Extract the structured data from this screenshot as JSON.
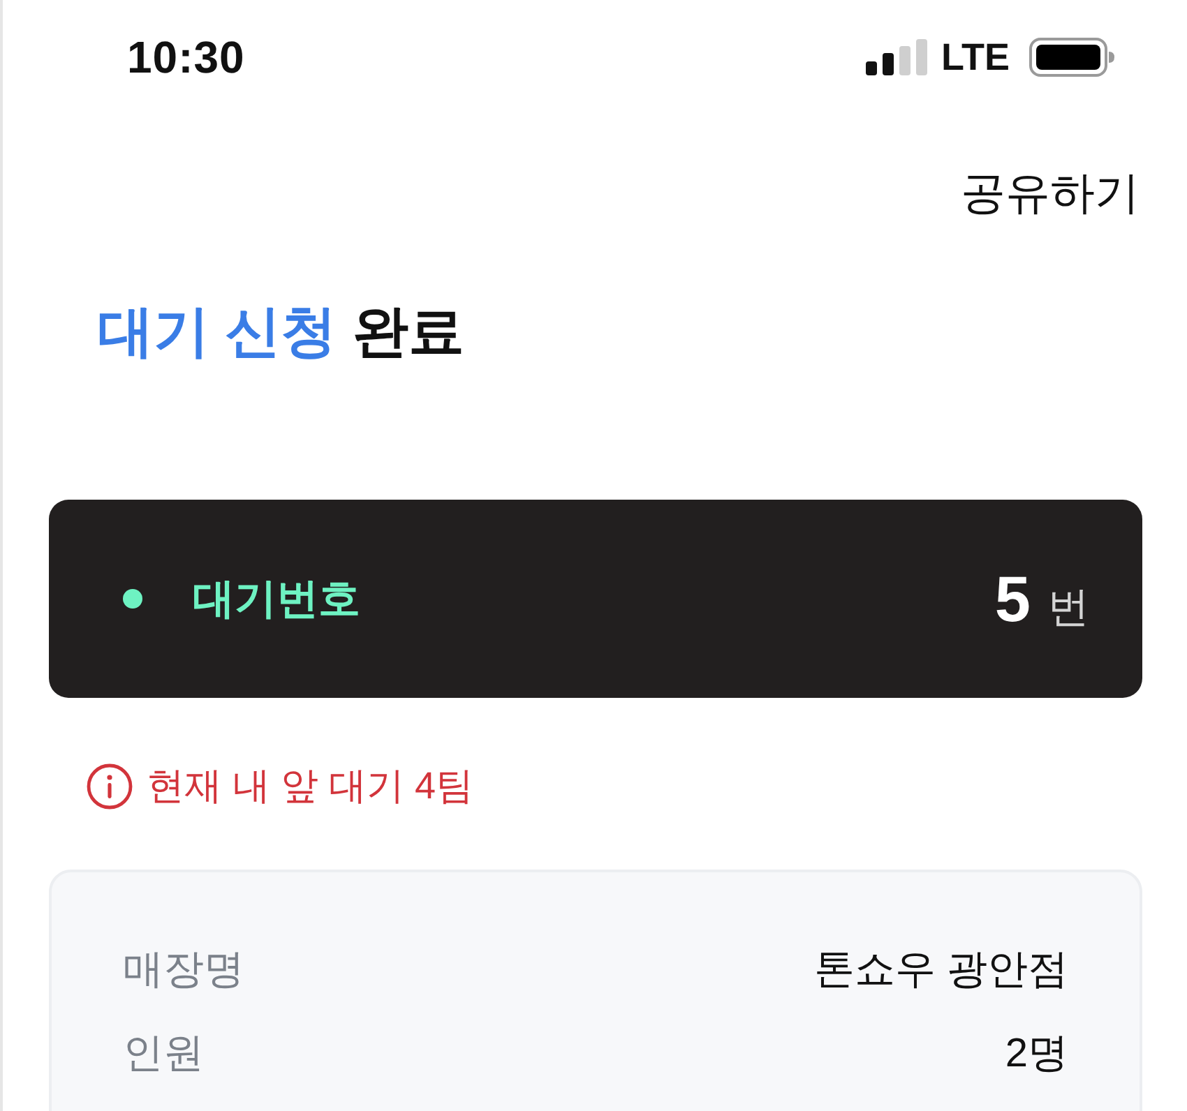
{
  "status_bar": {
    "time": "10:30",
    "network": "LTE"
  },
  "header": {
    "share_button": "공유하기"
  },
  "title": [
    {
      "text": "대기 신청",
      "highlight": true
    },
    {
      "text": "완료",
      "highlight": false
    }
  ],
  "ticket": {
    "label": "대기번호",
    "number": "5",
    "unit": "번"
  },
  "notice": {
    "text": "현재 내 앞 대기 4팀"
  },
  "details": [
    {
      "label": "매장명",
      "value": "톤쇼우 광안점"
    },
    {
      "label": "인원",
      "value": "2명"
    }
  ]
}
